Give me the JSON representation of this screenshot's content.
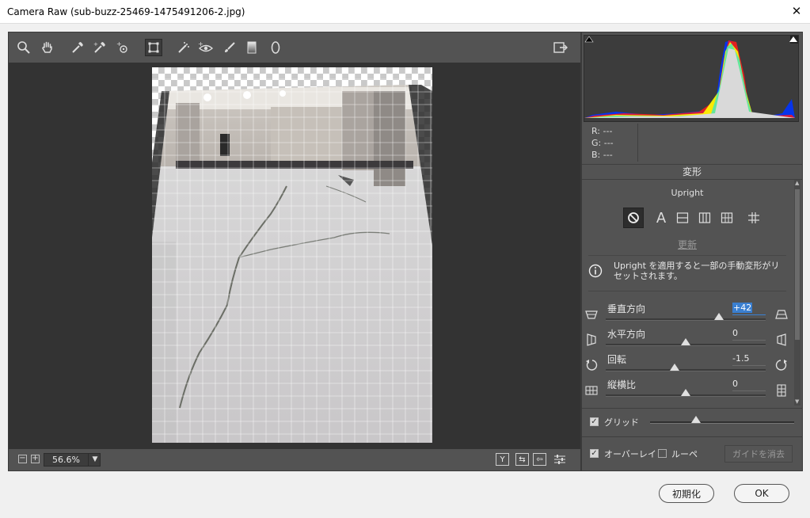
{
  "window": {
    "title": "Camera Raw (sub-buzz-25469-1475491206-2.jpg)"
  },
  "toolbar": {
    "tools": [
      {
        "name": "zoom-tool"
      },
      {
        "name": "hand-tool"
      },
      {
        "name": "white-balance-tool"
      },
      {
        "name": "color-sampler-tool"
      },
      {
        "name": "targeted-adjustment-tool"
      },
      {
        "name": "transform-tool",
        "active": true
      },
      {
        "name": "spot-removal-tool"
      },
      {
        "name": "red-eye-tool"
      },
      {
        "name": "adjustment-brush-tool"
      },
      {
        "name": "graduated-filter-tool"
      },
      {
        "name": "radial-filter-tool"
      }
    ]
  },
  "histogram": {
    "readout": {
      "r_label": "R:",
      "r_value": "---",
      "g_label": "G:",
      "g_value": "---",
      "b_label": "B:",
      "b_value": "---"
    }
  },
  "panel": {
    "title": "変形",
    "upright": {
      "label": "Upright",
      "a_label": "A",
      "update": "更新",
      "info": "Upright を適用すると一部の手動変形がリセットされます。"
    },
    "sliders": [
      {
        "label": "垂直方向",
        "value": "+42",
        "pos": 0.71
      },
      {
        "label": "水平方向",
        "value": "0",
        "pos": 0.5
      },
      {
        "label": "回転",
        "value": "-1.5",
        "pos": 0.43
      },
      {
        "label": "縦横比",
        "value": "0",
        "pos": 0.5
      }
    ],
    "grid": {
      "label": "グリッド",
      "checked": true,
      "pos": 0.32
    },
    "overlay": {
      "label": "オーバーレイ",
      "checked": true
    },
    "loupe": {
      "label": "ルーペ",
      "checked": false
    },
    "clear_guides": "ガイドを消去"
  },
  "bottom": {
    "zoom": "56.6%",
    "zoom_out": "−",
    "zoom_in": "+",
    "compare": "Y"
  },
  "dialog": {
    "reset": "初期化",
    "ok": "OK"
  }
}
